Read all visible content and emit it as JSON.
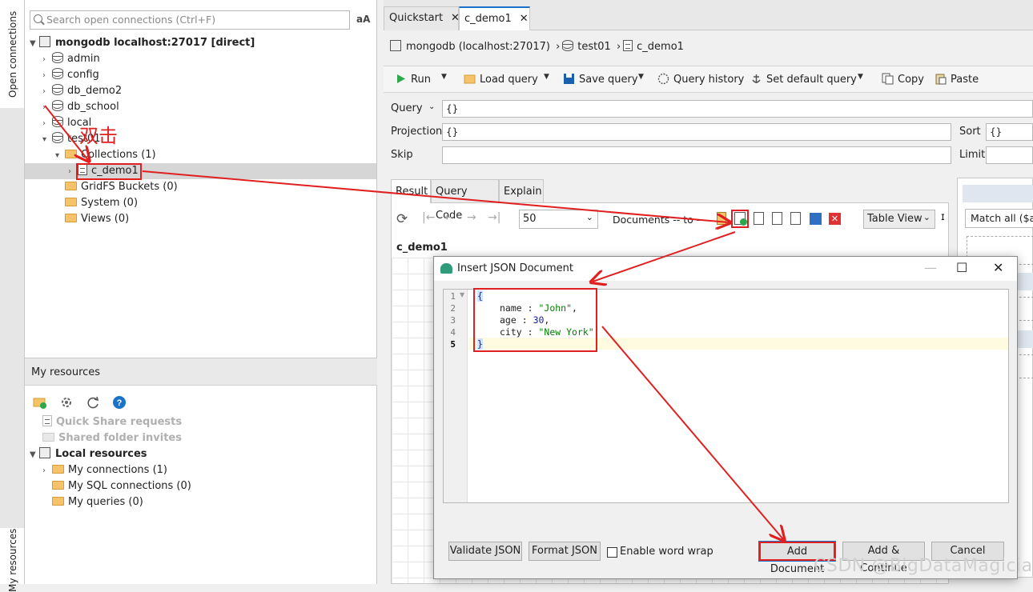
{
  "side_tabs": {
    "open_connections": "Open connections",
    "my_resources": "My resources"
  },
  "search": {
    "placeholder": "Search open connections (Ctrl+F)",
    "font_toggle": "aA"
  },
  "tree": {
    "connection": "mongodb localhost:27017 [direct]",
    "databases": [
      "admin",
      "config",
      "db_demo2",
      "db_school",
      "local",
      "test01"
    ],
    "collections_folder": "Collections (1)",
    "collection": "c_demo1",
    "folders": [
      "GridFS Buckets (0)",
      "System (0)",
      "Views (0)"
    ]
  },
  "annotation": {
    "double_click": "双击"
  },
  "resources": {
    "header": "My resources",
    "quick_share": "Quick Share requests",
    "shared_folder": "Shared folder invites",
    "local_resources": "Local resources",
    "items": [
      "My connections (1)",
      "My SQL connections (0)",
      "My queries (0)"
    ]
  },
  "tabs": {
    "quickstart": "Quickstart",
    "c_demo1": "c_demo1"
  },
  "breadcrumb": {
    "connection": "mongodb (localhost:27017)",
    "database": "test01",
    "collection": "c_demo1"
  },
  "toolbar": {
    "run": "Run",
    "load_query": "Load query",
    "save_query": "Save query",
    "query_history": "Query history",
    "set_default_query": "Set default query",
    "copy": "Copy",
    "paste": "Paste"
  },
  "query": {
    "query_label": "Query",
    "query_value": "{}",
    "projection_label": "Projection",
    "projection_value": "{}",
    "skip_label": "Skip",
    "sort_label": "Sort",
    "sort_value": "{}",
    "limit_label": "Limit"
  },
  "result_tabs": {
    "result": "Result",
    "query_code": "Query Code",
    "explain": "Explain"
  },
  "result_toolbar": {
    "page_size": "50",
    "documents": "Documents -- to --",
    "view": "Table View"
  },
  "result_title": "c_demo1",
  "right_pane": {
    "match_all": "Match all ($ar"
  },
  "dialog": {
    "title": "Insert JSON Document",
    "line_numbers": [
      "1",
      "2",
      "3",
      "4",
      "5"
    ],
    "code": {
      "open": "{",
      "name_key": "name",
      "name_value": "\"John\"",
      "age_key": "age",
      "age_value": "30",
      "city_key": "city",
      "city_value": "\"New York\"",
      "close": "}"
    },
    "validate": "Validate JSON",
    "format": "Format JSON",
    "word_wrap": "Enable word wrap",
    "add_document": "Add Document",
    "add_continue": "Add & Continue",
    "cancel": "Cancel"
  },
  "watermark": "CSDN @BigDataMagician",
  "colors": {
    "annotation_red": "#e02020",
    "accent_blue": "#1a73c8",
    "string_green": "#008000",
    "number_blue": "#1a1aa6"
  }
}
